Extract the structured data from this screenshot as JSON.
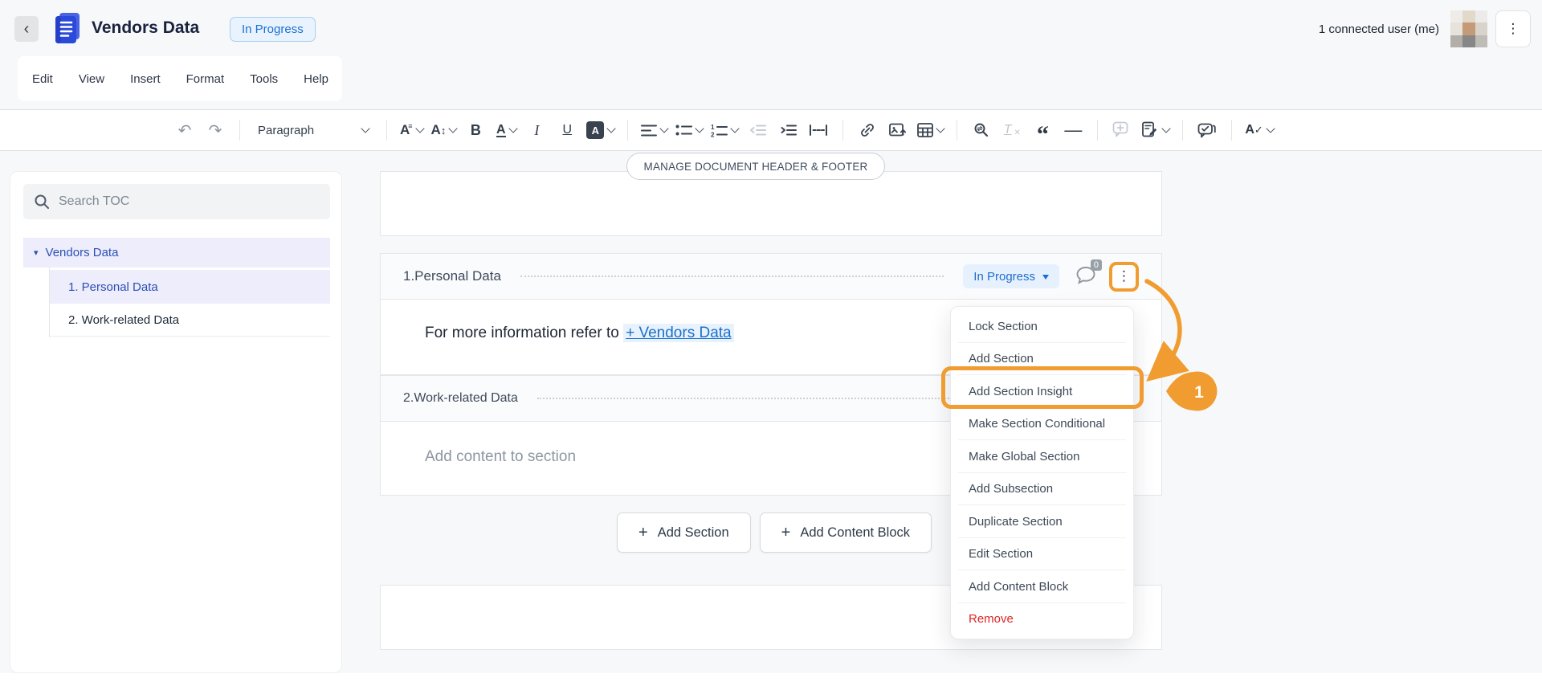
{
  "header": {
    "back": "‹",
    "title": "Vendors Data",
    "status": "In Progress",
    "connected": "1 connected user (me)",
    "kebab": "⋮"
  },
  "menus": [
    "Edit",
    "View",
    "Insert",
    "Format",
    "Tools",
    "Help"
  ],
  "toolbar": {
    "undo": "↶",
    "redo": "↷",
    "paragraph": "Paragraph",
    "font_family": "A",
    "font_family_lines": "≡",
    "font_size": "A",
    "font_size_arrows": "↕",
    "bold": "B",
    "font_color": "A",
    "italic": "I",
    "underline": "U",
    "highlight": "A",
    "clear_format": "T",
    "clear_format_x": "✕",
    "quote": "“",
    "hr": "—",
    "spellcheck": "A",
    "spellcheck_check": "✓"
  },
  "sidebar": {
    "search_placeholder": "Search TOC",
    "root_caret": "▾",
    "root": "Vendors Data",
    "items": [
      "1. Personal Data",
      "2. Work-related Data"
    ]
  },
  "document": {
    "manage_pill": "MANAGE DOCUMENT HEADER & FOOTER",
    "section1_title": "1.Personal Data",
    "section1_status": "In Progress",
    "comment_count": "0",
    "section_kebab": "⋮",
    "body_prefix": "For more information refer to ",
    "body_link": "+ Vendors Data",
    "section2_title": "2.Work-related Data",
    "empty_placeholder": "Add content to section",
    "plus": "+",
    "add_section": "Add Section",
    "add_content_block": "Add Content Block"
  },
  "context_menu": {
    "items": [
      "Lock Section",
      "Add Section",
      "Add Section Insight",
      "Make Section Conditional",
      "Make Global Section",
      "Add Subsection",
      "Duplicate Section",
      "Edit Section",
      "Add Content Block",
      "Remove"
    ]
  },
  "annotation": {
    "step": "1"
  },
  "colors": {
    "annotation_orange": "#F09C30",
    "accent_blue": "#1D6FD1",
    "tree_blue": "#2C4FB5",
    "danger_red": "#DC2626"
  }
}
